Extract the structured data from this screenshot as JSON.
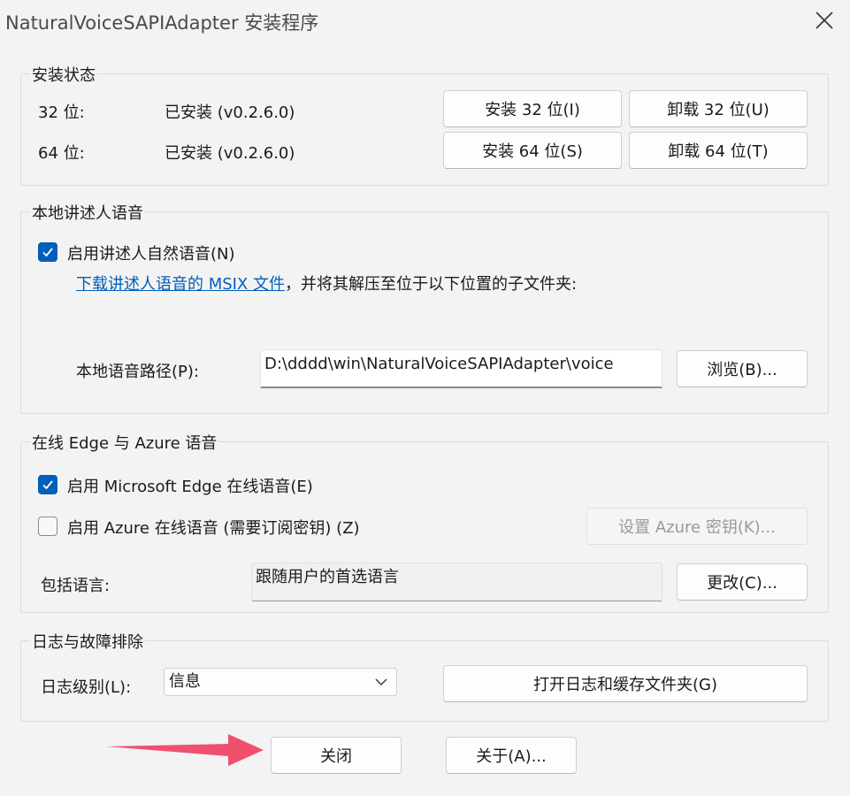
{
  "window": {
    "title": "NaturalVoiceSAPIAdapter 安装程序"
  },
  "install_status": {
    "title": "安装状态",
    "rows": [
      {
        "label": "32 位:",
        "status": "已安装 (v0.2.6.0)",
        "install_label": "安装 32 位(I)",
        "uninstall_label": "卸载 32 位(U)"
      },
      {
        "label": "64 位:",
        "status": "已安装 (v0.2.6.0)",
        "install_label": "安装 64 位(S)",
        "uninstall_label": "卸载 64 位(T)"
      }
    ]
  },
  "local_voice": {
    "title": "本地讲述人语音",
    "enable_label": "启用讲述人自然语音(N)",
    "enable_checked": true,
    "download_link": "下载讲述人语音的 MSIX 文件",
    "download_suffix": "，并将其解压至位于以下位置的子文件夹:",
    "path_label": "本地语音路径(P):",
    "path_value": "D:\\dddd\\win\\NaturalVoiceSAPIAdapter\\voice",
    "browse_label": "浏览(B)..."
  },
  "online_voice": {
    "title": "在线 Edge 与 Azure 语音",
    "edge_label": "启用 Microsoft Edge 在线语音(E)",
    "edge_checked": true,
    "azure_label": "启用 Azure 在线语音 (需要订阅密钥) (Z)",
    "azure_checked": false,
    "azure_key_label": "设置 Azure 密钥(K)...",
    "languages_label": "包括语言:",
    "languages_value": "跟随用户的首选语言",
    "change_label": "更改(C)..."
  },
  "logging": {
    "title": "日志与故障排除",
    "level_label": "日志级别(L):",
    "level_value": "信息",
    "open_folder_label": "打开日志和缓存文件夹(G)"
  },
  "footer": {
    "close_label": "关闭",
    "about_label": "关于(A)..."
  },
  "colors": {
    "accent": "#005fb8",
    "arrow": "#f0506e"
  }
}
